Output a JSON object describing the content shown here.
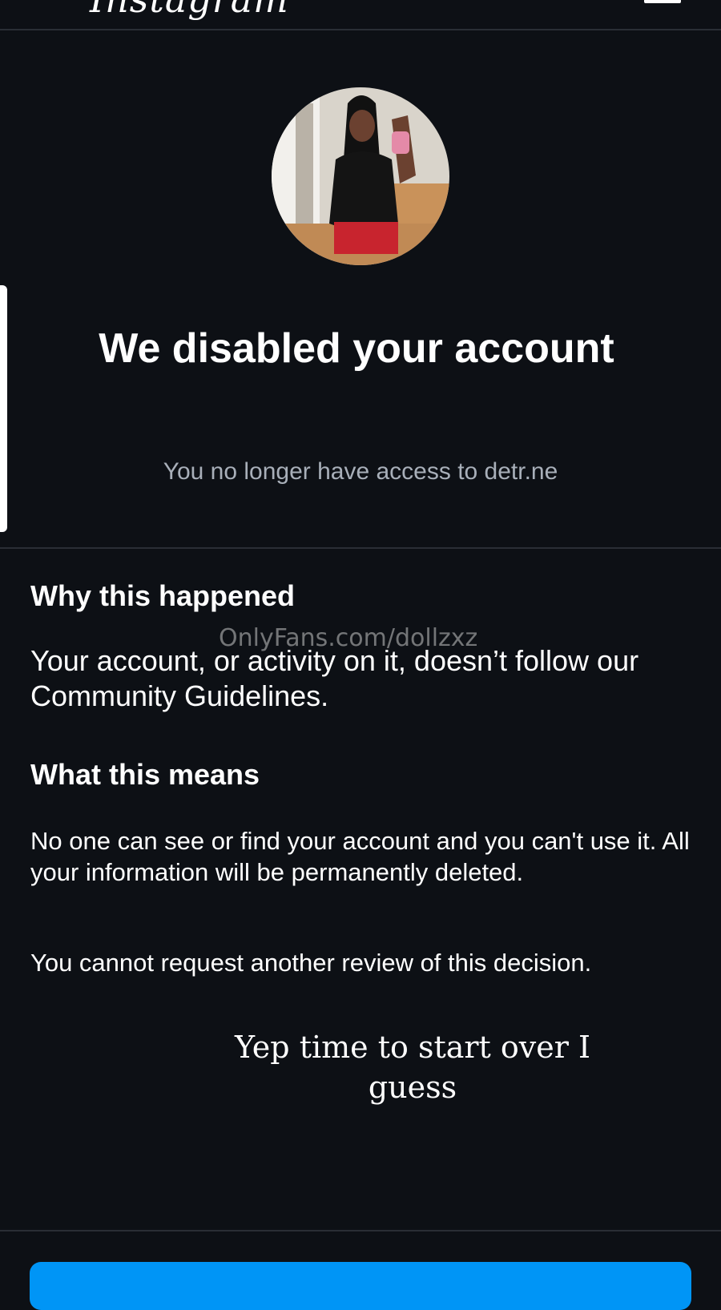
{
  "header": {
    "logo_text": "Instagram",
    "menu_icon": "hamburger-icon"
  },
  "profile": {
    "avatar_icon": "profile-photo"
  },
  "notice": {
    "headline": "We disabled your account",
    "subtitle": "You no longer have access to detr.ne"
  },
  "why": {
    "title": "Why this happened",
    "body": "Your account, or activity on it, doesn’t follow our Community Guidelines."
  },
  "means": {
    "title": "What this means",
    "body": "No one can see or find your account and you can't use it. All your information will be permanently deleted.",
    "review_note": "You cannot request another review of this decision."
  },
  "overlay": {
    "watermark": "OnlyFans.com/dollzxz",
    "caption": "Yep time to start over I guess"
  },
  "colors": {
    "background": "#0d1015",
    "subtle_text": "#a8afb9",
    "divider": "#2a2e35",
    "accent_button": "#0095f6"
  }
}
